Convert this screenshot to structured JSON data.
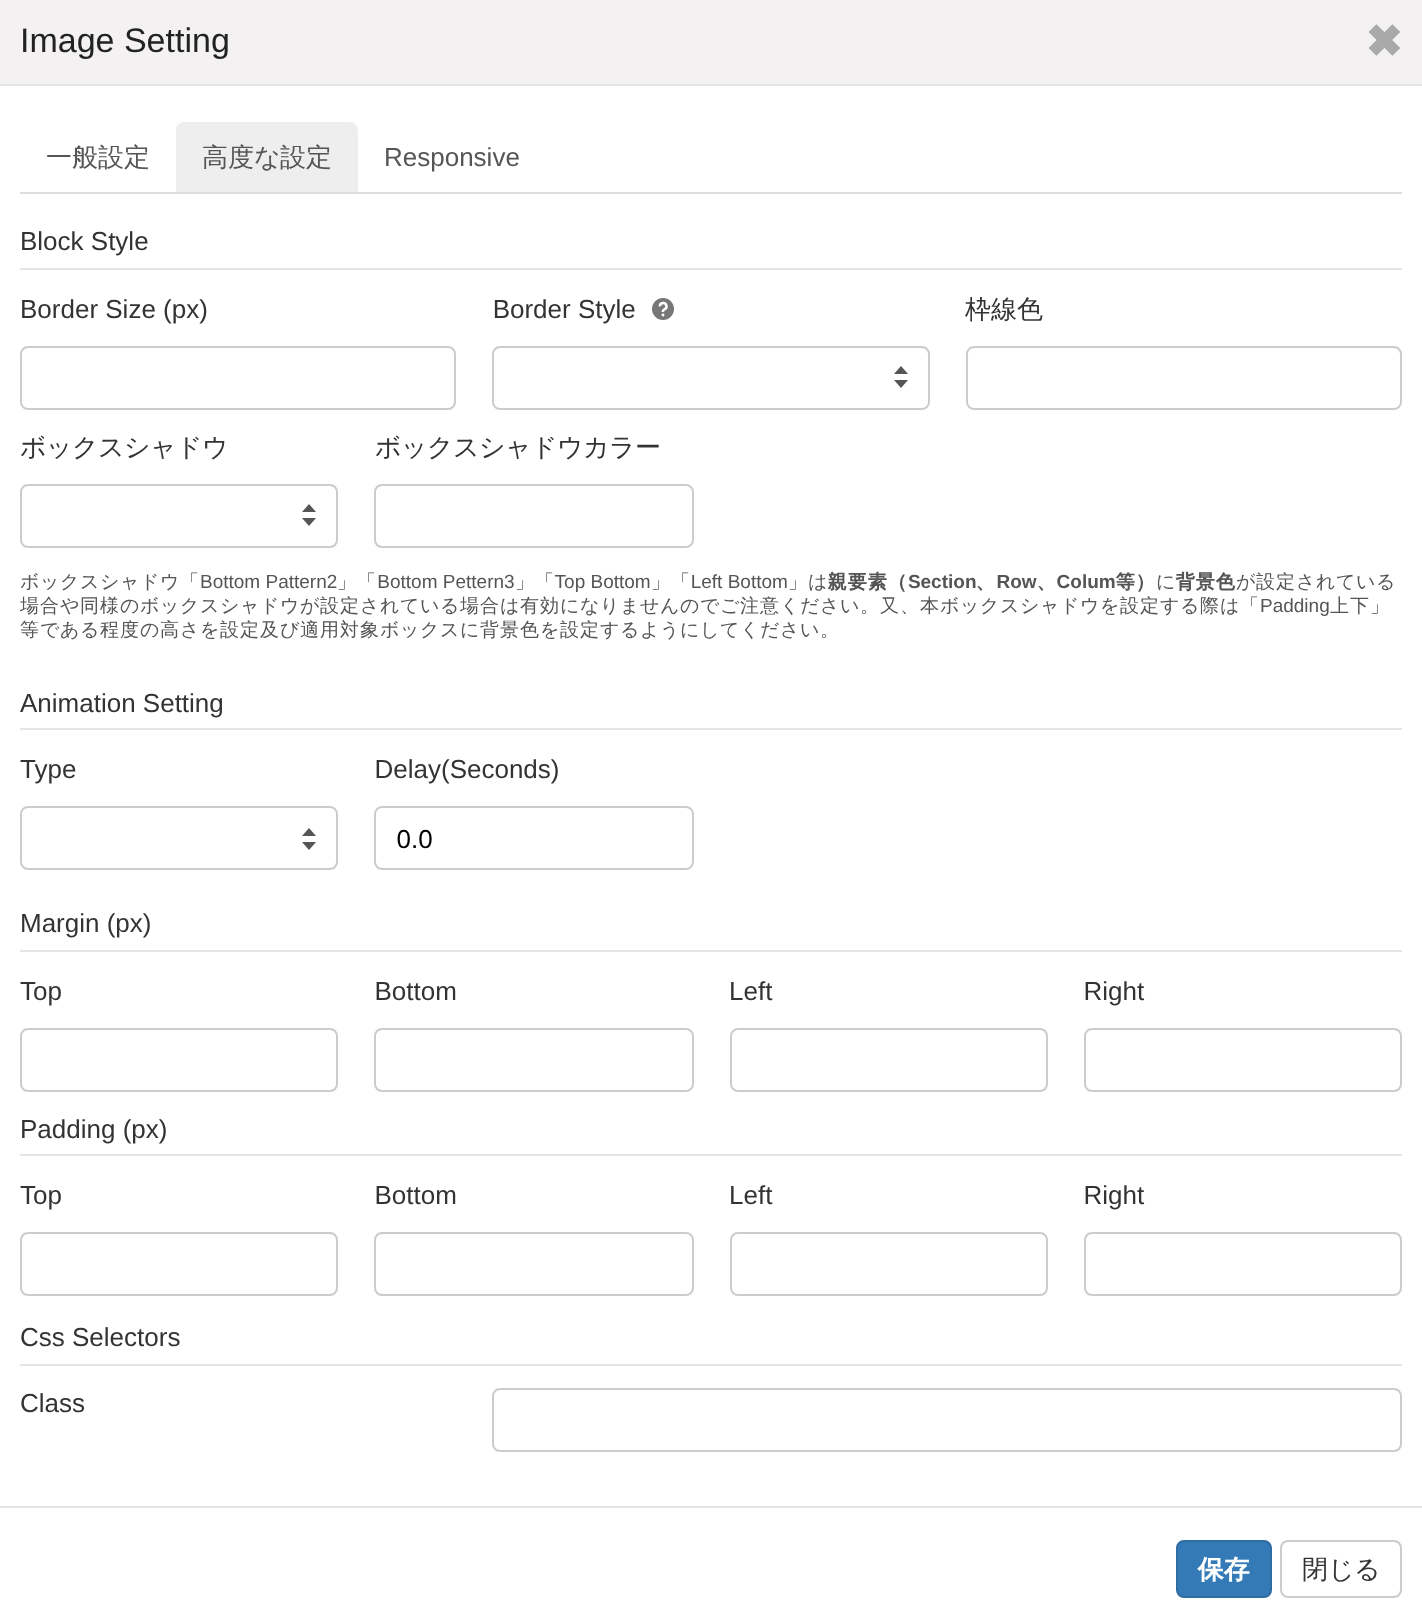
{
  "window": {
    "title": "Image Setting",
    "close": "✖"
  },
  "tabs": [
    {
      "label": "一般設定",
      "selected": false
    },
    {
      "label": "高度な設定",
      "selected": true
    },
    {
      "label": "Responsive",
      "selected": false
    }
  ],
  "sections": [
    {
      "title": "Block Style",
      "rows": [
        [
          {
            "label": "Border Size (px)",
            "kind": "text"
          },
          {
            "label": "Border Style",
            "kind": "select",
            "help": true
          },
          {
            "label": "枠線色",
            "kind": "text"
          }
        ],
        [
          {
            "label": "ボックスシャドウ",
            "kind": "select"
          },
          {
            "label": "ボックスシャドウカラー",
            "kind": "text"
          }
        ]
      ],
      "note": "ボックスシャドウ「Bottom Pattern2」「Bottom Pettern3」「Top Bottom」「Left Bottom」は**親要素（Section、Row、Colum等）**に**背景色**が設定されている場合や同様のボックスシャドウが設定されている場合は有効になりませんのでご注意ください。又、本ボックスシャドウを設定する際は「Padding上下」等である程度の高さを設定及び適用対象ボックスに背景色を設定するようにしてください。"
    },
    {
      "title": "Animation Setting",
      "rows": [
        [
          {
            "label": "Type",
            "kind": "select"
          },
          {
            "label": "Delay(Seconds)",
            "kind": "text",
            "value": "0.0"
          }
        ]
      ]
    },
    {
      "title": "Margin (px)",
      "rows": [
        [
          {
            "label": "Top",
            "kind": "text"
          },
          {
            "label": "Bottom",
            "kind": "text"
          },
          {
            "label": "Left",
            "kind": "text"
          },
          {
            "label": "Right",
            "kind": "text"
          }
        ]
      ]
    },
    {
      "title": "Padding (px)",
      "rows": [
        [
          {
            "label": "Top",
            "kind": "text"
          },
          {
            "label": "Bottom",
            "kind": "text"
          },
          {
            "label": "Left",
            "kind": "text"
          },
          {
            "label": "Right",
            "kind": "text"
          }
        ]
      ]
    },
    {
      "title": "Css Selectors",
      "rows": [
        [
          {
            "label": "Class",
            "kind": "wide-text"
          }
        ]
      ]
    }
  ],
  "buttons": [
    {
      "label": "保存",
      "primary": true
    },
    {
      "label": "閉じる",
      "primary": false
    }
  ]
}
